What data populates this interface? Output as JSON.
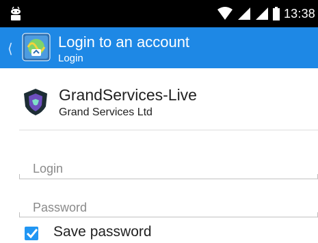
{
  "status_bar": {
    "time": "13:38"
  },
  "appbar": {
    "title": "Login to an account",
    "subtitle": "Login"
  },
  "server": {
    "name": "GrandServices-Live",
    "company": "Grand Services Ltd"
  },
  "form": {
    "login_placeholder": "Login",
    "password_placeholder": "Password",
    "save_password_label": "Save password",
    "save_password_checked": true
  },
  "colors": {
    "appbar": "#1e88e5",
    "accent": "#2196f3",
    "status_bar": "#000000"
  }
}
